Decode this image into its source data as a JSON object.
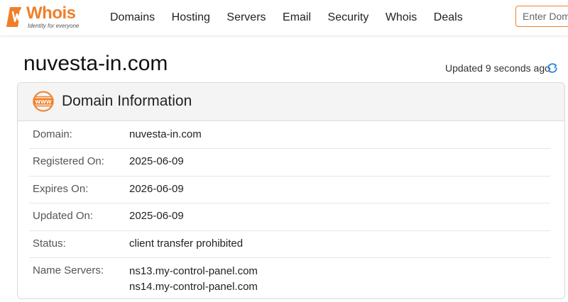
{
  "logo": {
    "word": "Whois",
    "tagline": "Identity for everyone"
  },
  "nav": {
    "items": [
      {
        "label": "Domains"
      },
      {
        "label": "Hosting"
      },
      {
        "label": "Servers"
      },
      {
        "label": "Email"
      },
      {
        "label": "Security"
      },
      {
        "label": "Whois"
      },
      {
        "label": "Deals"
      }
    ]
  },
  "search": {
    "placeholder": "Enter Domain"
  },
  "page": {
    "title": "nuvesta-in.com",
    "updated": "Updated 9 seconds ago"
  },
  "card": {
    "title": "Domain Information",
    "rows": [
      {
        "label": "Domain:",
        "value": "nuvesta-in.com"
      },
      {
        "label": "Registered On:",
        "value": "2025-06-09"
      },
      {
        "label": "Expires On:",
        "value": "2026-06-09"
      },
      {
        "label": "Updated On:",
        "value": "2025-06-09"
      },
      {
        "label": "Status:",
        "value": "client transfer prohibited"
      },
      {
        "label": "Name Servers:",
        "values": [
          "ns13.my-control-panel.com",
          "ns14.my-control-panel.com"
        ]
      }
    ]
  },
  "colors": {
    "brand": "#f07f29",
    "refresh": "#2f86d6"
  },
  "icons": {
    "logo": "whois-logo-icon",
    "card": "www-globe-icon",
    "refresh": "refresh-icon"
  }
}
